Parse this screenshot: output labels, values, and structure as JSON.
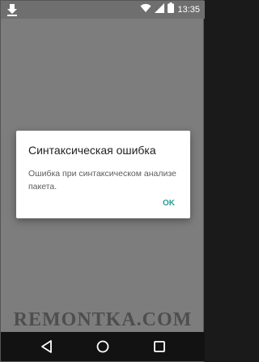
{
  "status_bar": {
    "time": "13:35",
    "icons": [
      "download-icon",
      "wifi-icon",
      "signal-icon",
      "battery-icon"
    ]
  },
  "dialog": {
    "title": "Синтаксическая ошибка",
    "message": "Ошибка при синтаксическом анализе пакета.",
    "ok_label": "OK"
  },
  "watermark": "REMONTKA.COM",
  "navigation": {
    "icons": [
      "back-icon",
      "home-icon",
      "recents-icon"
    ]
  },
  "colors": {
    "accent": "#2a9d8f",
    "scrim": "#7d7d7d"
  }
}
